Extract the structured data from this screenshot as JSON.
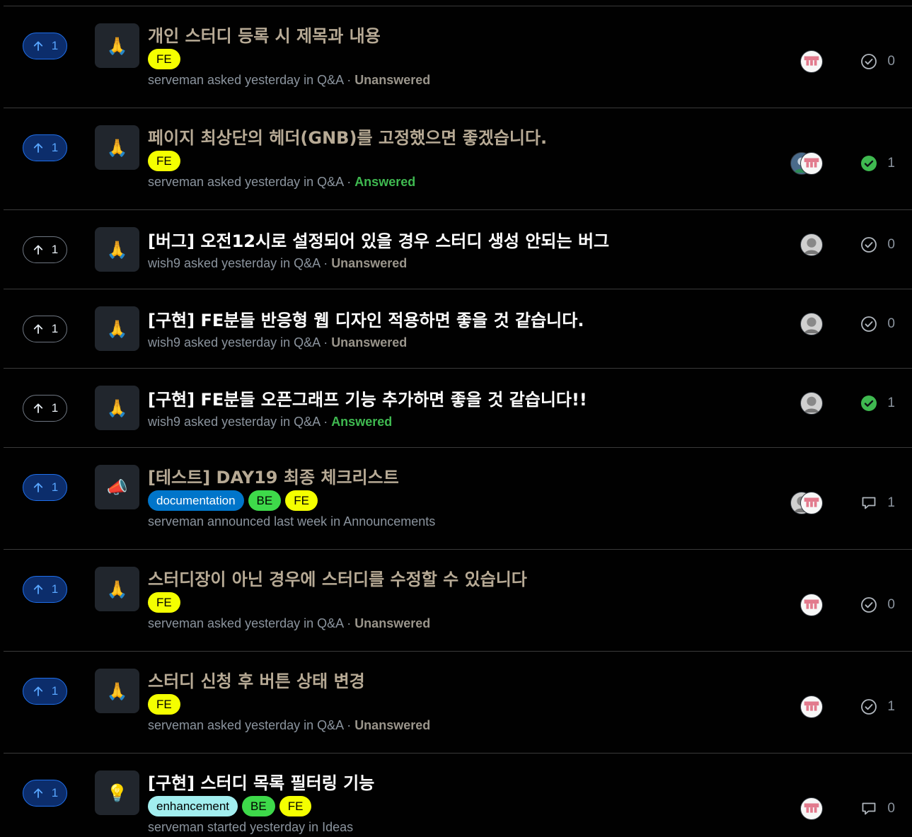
{
  "colors": {
    "accent": "#58a6ff",
    "answered": "#3fb950",
    "fe_label": "#f4ff00",
    "be_label": "#3ed94a",
    "doc_label": "#0075ca",
    "enh_label": "#a2eeef"
  },
  "rows": [
    {
      "votes": "1",
      "vote_active": true,
      "category_icon": "pray-icon",
      "title": "개인 스터디 등록 시 제목과 내용",
      "labels": [
        "FE"
      ],
      "author": "serveman",
      "action": "asked yesterday in",
      "category": "Q&A",
      "status": "Unanswered",
      "answered": false,
      "stat_icon": "check-circle-icon",
      "stat_value": "0",
      "avatars": [
        "pink"
      ]
    },
    {
      "votes": "1",
      "vote_active": true,
      "category_icon": "pray-icon",
      "title": "페이지 최상단의 헤더(GNB)를 고정했으면 좋겠습니다.",
      "labels": [
        "FE"
      ],
      "author": "serveman",
      "action": "asked yesterday in",
      "category": "Q&A",
      "status": "Answered",
      "answered": true,
      "stat_icon": "check-circle-filled-icon",
      "stat_value": "1",
      "avatars": [
        "blue",
        "pink"
      ]
    },
    {
      "votes": "1",
      "vote_active": false,
      "category_icon": "pray-icon",
      "title": "[버그] 오전12시로 설정되어 있을 경우 스터디 생성 안되는 버그",
      "labels": [],
      "author": "wish9",
      "action": "asked yesterday in",
      "category": "Q&A",
      "status": "Unanswered",
      "answered": false,
      "stat_icon": "check-circle-icon",
      "stat_value": "0",
      "avatars": [
        "gray"
      ]
    },
    {
      "votes": "1",
      "vote_active": false,
      "category_icon": "pray-icon",
      "title": "[구현] FE분들 반응형 웹 디자인 적용하면 좋을 것 같습니다.",
      "labels": [],
      "author": "wish9",
      "action": "asked yesterday in",
      "category": "Q&A",
      "status": "Unanswered",
      "answered": false,
      "stat_icon": "check-circle-icon",
      "stat_value": "0",
      "avatars": [
        "gray"
      ]
    },
    {
      "votes": "1",
      "vote_active": false,
      "category_icon": "pray-icon",
      "title": "[구현] FE분들 오픈그래프 기능 추가하면 좋을 것 같습니다!!",
      "labels": [],
      "author": "wish9",
      "action": "asked yesterday in",
      "category": "Q&A",
      "status": "Answered",
      "answered": true,
      "stat_icon": "check-circle-filled-icon",
      "stat_value": "1",
      "avatars": [
        "gray"
      ]
    },
    {
      "votes": "1",
      "vote_active": true,
      "category_icon": "megaphone-icon",
      "title": "[테스트] DAY19 최종 체크리스트",
      "labels": [
        "documentation",
        "BE",
        "FE"
      ],
      "author": "serveman",
      "action": "announced last week in",
      "category": "Announcements",
      "status": "",
      "answered": false,
      "stat_icon": "comment-icon",
      "stat_value": "1",
      "avatars": [
        "gray",
        "pink"
      ]
    },
    {
      "votes": "1",
      "vote_active": true,
      "category_icon": "pray-icon",
      "title": "스터디장이 아닌 경우에 스터디를 수정할 수 있습니다",
      "labels": [
        "FE"
      ],
      "author": "serveman",
      "action": "asked yesterday in",
      "category": "Q&A",
      "status": "Unanswered",
      "answered": false,
      "stat_icon": "check-circle-icon",
      "stat_value": "0",
      "avatars": [
        "pink"
      ]
    },
    {
      "votes": "1",
      "vote_active": true,
      "category_icon": "pray-icon",
      "title": "스터디 신청 후 버튼 상태 변경",
      "labels": [
        "FE"
      ],
      "author": "serveman",
      "action": "asked yesterday in",
      "category": "Q&A",
      "status": "Unanswered",
      "answered": false,
      "stat_icon": "check-circle-icon",
      "stat_value": "1",
      "avatars": [
        "pink"
      ]
    },
    {
      "votes": "1",
      "vote_active": true,
      "category_icon": "bulb-icon",
      "title": "[구현] 스터디 목록 필터링 기능",
      "labels": [
        "enhancement",
        "BE",
        "FE"
      ],
      "author": "serveman",
      "action": "started yesterday in",
      "category": "Ideas",
      "status": "",
      "answered": false,
      "stat_icon": "comment-icon",
      "stat_value": "0",
      "avatars": [
        "pink"
      ]
    }
  ]
}
